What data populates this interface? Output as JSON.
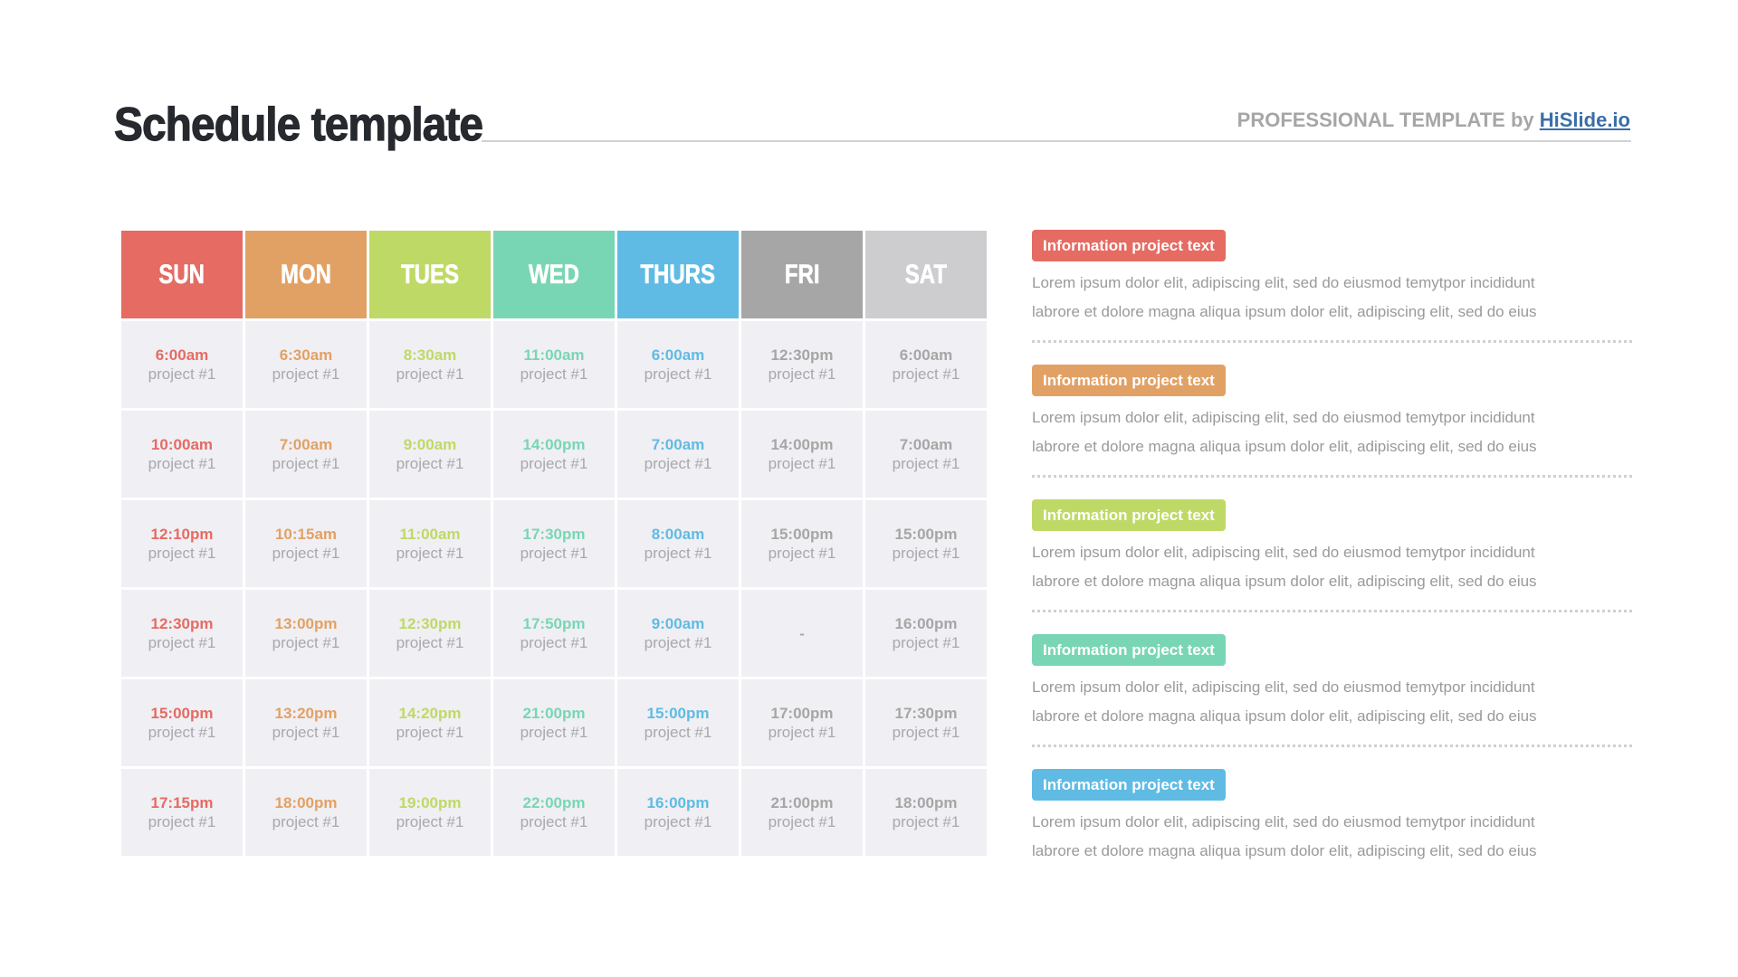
{
  "header": {
    "title": "Schedule template",
    "brand_prefix": "PROFESSIONAL TEMPLATE by ",
    "brand_link": "HiSlide.io"
  },
  "colors": {
    "sun": "#e56b63",
    "mon": "#e2a164",
    "tues": "#bfd966",
    "wed": "#79d6b4",
    "thurs": "#5fbbe4",
    "fri": "#a6a6a6",
    "sat": "#cdcccf",
    "fri_text": "#a6a6a6",
    "sat_text": "#a6a6a6"
  },
  "schedule": {
    "days": [
      {
        "label": "SUN",
        "color_key": "sun"
      },
      {
        "label": "MON",
        "color_key": "mon"
      },
      {
        "label": "TUES",
        "color_key": "tues"
      },
      {
        "label": "WED",
        "color_key": "wed"
      },
      {
        "label": "THURS",
        "color_key": "thurs"
      },
      {
        "label": "FRI",
        "color_key": "fri"
      },
      {
        "label": "SAT",
        "color_key": "sat"
      }
    ],
    "rows": [
      [
        {
          "time": "6:00am",
          "project": "project #1"
        },
        {
          "time": "6:30am",
          "project": "project #1"
        },
        {
          "time": "8:30am",
          "project": "project #1"
        },
        {
          "time": "11:00am",
          "project": "project #1"
        },
        {
          "time": "6:00am",
          "project": "project #1"
        },
        {
          "time": "12:30pm",
          "project": "project #1"
        },
        {
          "time": "6:00am",
          "project": "project #1"
        }
      ],
      [
        {
          "time": "10:00am",
          "project": "project #1"
        },
        {
          "time": "7:00am",
          "project": "project #1"
        },
        {
          "time": "9:00am",
          "project": "project #1"
        },
        {
          "time": "14:00pm",
          "project": "project #1"
        },
        {
          "time": "7:00am",
          "project": "project #1"
        },
        {
          "time": "14:00pm",
          "project": "project #1"
        },
        {
          "time": "7:00am",
          "project": "project #1"
        }
      ],
      [
        {
          "time": "12:10pm",
          "project": "project #1"
        },
        {
          "time": "10:15am",
          "project": "project #1"
        },
        {
          "time": "11:00am",
          "project": "project #1"
        },
        {
          "time": "17:30pm",
          "project": "project #1"
        },
        {
          "time": "8:00am",
          "project": "project #1"
        },
        {
          "time": "15:00pm",
          "project": "project #1"
        },
        {
          "time": "15:00pm",
          "project": "project #1"
        }
      ],
      [
        {
          "time": "12:30pm",
          "project": "project #1"
        },
        {
          "time": "13:00pm",
          "project": "project #1"
        },
        {
          "time": "12:30pm",
          "project": "project #1"
        },
        {
          "time": "17:50pm",
          "project": "project #1"
        },
        {
          "time": "9:00am",
          "project": "project #1"
        },
        {
          "empty": "-"
        },
        {
          "time": "16:00pm",
          "project": "project #1"
        }
      ],
      [
        {
          "time": "15:00pm",
          "project": "project #1"
        },
        {
          "time": "13:20pm",
          "project": "project #1"
        },
        {
          "time": "14:20pm",
          "project": "project #1"
        },
        {
          "time": "21:00pm",
          "project": "project #1"
        },
        {
          "time": "15:00pm",
          "project": "project #1"
        },
        {
          "time": "17:00pm",
          "project": "project #1"
        },
        {
          "time": "17:30pm",
          "project": "project #1"
        }
      ],
      [
        {
          "time": "17:15pm",
          "project": "project #1"
        },
        {
          "time": "18:00pm",
          "project": "project #1"
        },
        {
          "time": "19:00pm",
          "project": "project #1"
        },
        {
          "time": "22:00pm",
          "project": "project #1"
        },
        {
          "time": "16:00pm",
          "project": "project #1"
        },
        {
          "time": "21:00pm",
          "project": "project #1"
        },
        {
          "time": "18:00pm",
          "project": "project #1"
        }
      ]
    ]
  },
  "info": {
    "items": [
      {
        "badge": "Information project text",
        "color_key": "sun",
        "line1": "Lorem ipsum dolor elit, adipiscing elit, sed do eiusmod temytpor incididunt",
        "line2": "labrore et dolore magna aliqua ipsum dolor elit, adipiscing elit, sed do eius"
      },
      {
        "badge": "Information project text",
        "color_key": "mon",
        "line1": "Lorem ipsum dolor elit, adipiscing elit, sed do eiusmod temytpor incididunt",
        "line2": "labrore et dolore magna aliqua ipsum dolor elit, adipiscing elit, sed do eius"
      },
      {
        "badge": "Information project text",
        "color_key": "tues",
        "line1": "Lorem ipsum dolor elit, adipiscing elit, sed do eiusmod temytpor incididunt",
        "line2": "labrore et dolore magna aliqua ipsum dolor elit, adipiscing elit, sed do eius"
      },
      {
        "badge": "Information project text",
        "color_key": "wed",
        "line1": "Lorem ipsum dolor elit, adipiscing elit, sed do eiusmod temytpor incididunt",
        "line2": "labrore et dolore magna aliqua ipsum dolor elit, adipiscing elit, sed do eius"
      },
      {
        "badge": "Information project text",
        "color_key": "thurs",
        "line1": "Lorem ipsum dolor elit, adipiscing elit, sed do eiusmod temytpor incididunt",
        "line2": "labrore et dolore magna aliqua ipsum dolor elit, adipiscing elit, sed do eius"
      }
    ]
  }
}
